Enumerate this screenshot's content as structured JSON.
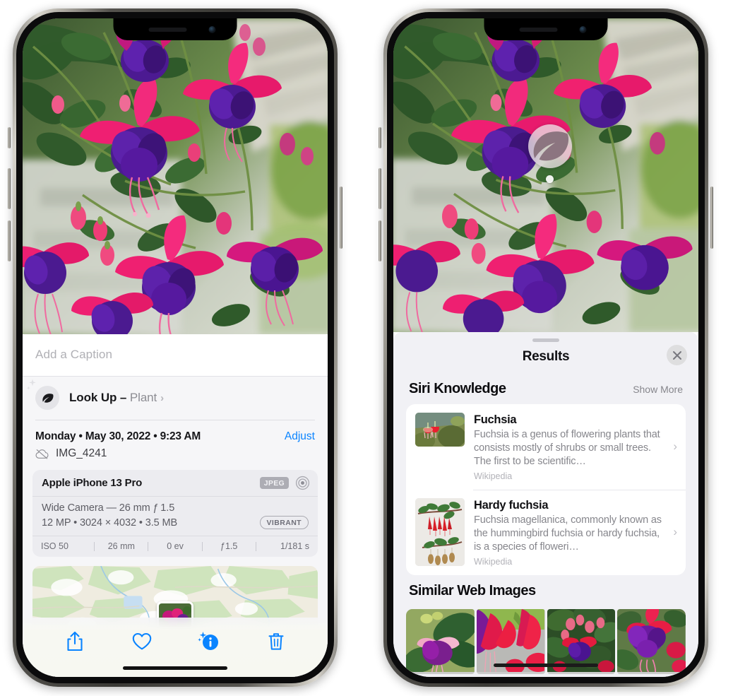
{
  "left_phone": {
    "screen_name": "photos-info-detail",
    "caption": {
      "placeholder": "Add a Caption",
      "value": ""
    },
    "lookup": {
      "icon": "leaf-icon",
      "label": "Look Up",
      "dash": "–",
      "subject": "Plant",
      "chevron": "›"
    },
    "meta": {
      "datetime": "Monday • May 30, 2022 • 9:23 AM",
      "adjust_label": "Adjust",
      "filename": "IMG_4241",
      "cloud_icon": "cloud-slash-icon"
    },
    "exif": {
      "device": "Apple iPhone 13 Pro",
      "format_badge": "JPEG",
      "raw_icon": "aperture-icon",
      "lens_line": "Wide Camera — 26 mm ƒ 1.5",
      "size_line": "12 MP • 3024 × 4032 • 3.5 MB",
      "profile_badge": "VIBRANT",
      "stats": [
        "ISO 50",
        "26 mm",
        "0 ev",
        "ƒ1.5",
        "1/181 s"
      ]
    },
    "map": {
      "name": "location-map-preview",
      "pin": "photo-thumbnail-pin"
    },
    "toolbar": [
      {
        "name": "share-button",
        "icon": "share-icon"
      },
      {
        "name": "favorite-button",
        "icon": "heart-icon"
      },
      {
        "name": "info-button",
        "icon": "info-sparkle-icon"
      },
      {
        "name": "delete-button",
        "icon": "trash-icon"
      }
    ]
  },
  "right_phone": {
    "screen_name": "visual-lookup-results",
    "photo_badge": {
      "icon": "leaf-icon",
      "name": "visual-lookup-badge"
    },
    "sheet": {
      "title": "Results",
      "close_icon": "close-icon",
      "sections": [
        {
          "title": "Siri Knowledge",
          "action": "Show More",
          "items": [
            {
              "title": "Fuchsia",
              "description": "Fuchsia is a genus of flowering plants that consists mostly of shrubs or small trees. The first to be scientific…",
              "source": "Wikipedia",
              "thumb": "fuchsia-red-flowers-thumb",
              "chevron": "›"
            },
            {
              "title": "Hardy fuchsia",
              "description": "Fuchsia magellanica, commonly known as the hummingbird fuchsia or hardy fuchsia, is a species of floweri…",
              "source": "Wikipedia",
              "thumb": "hardy-fuchsia-specimen-thumb",
              "chevron": "›"
            }
          ]
        },
        {
          "title": "Similar Web Images",
          "images": [
            "fuchsia-pink-purple-leaf-thumb",
            "fuchsia-red-closeup-thumb",
            "fuchsia-bush-thumb",
            "fuchsia-purple-red-cluster-thumb"
          ]
        }
      ]
    }
  },
  "colors": {
    "accent_blue": "#0a84ff",
    "sheet_bg": "#f1f1f5",
    "card_bg": "#ffffff",
    "secondary_text": "#86868c"
  }
}
